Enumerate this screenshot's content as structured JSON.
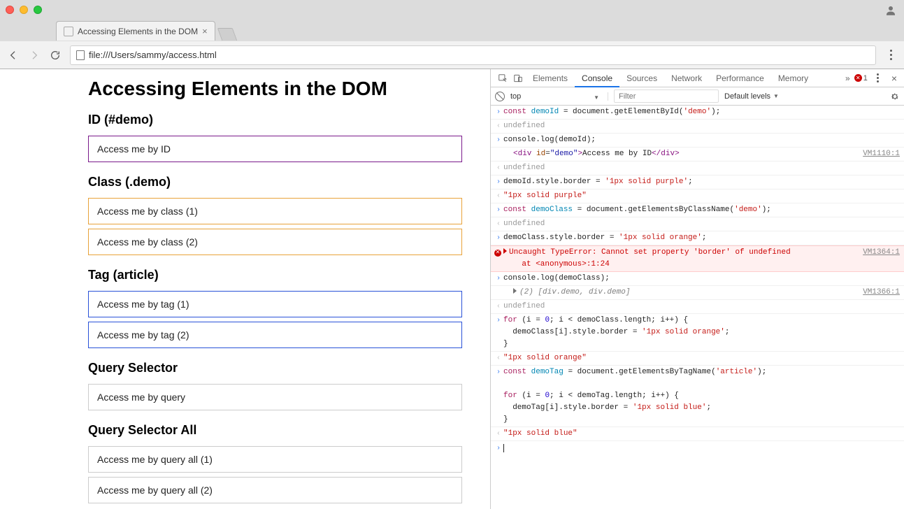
{
  "browser": {
    "tab_title": "Accessing Elements in the DOM",
    "url": "file:///Users/sammy/access.html"
  },
  "page": {
    "h1": "Accessing Elements in the DOM",
    "sections": {
      "id": {
        "heading": "ID (#demo)",
        "box1": "Access me by ID"
      },
      "class": {
        "heading": "Class (.demo)",
        "box1": "Access me by class (1)",
        "box2": "Access me by class (2)"
      },
      "tag": {
        "heading": "Tag (article)",
        "box1": "Access me by tag (1)",
        "box2": "Access me by tag (2)"
      },
      "query": {
        "heading": "Query Selector",
        "box1": "Access me by query"
      },
      "queryall": {
        "heading": "Query Selector All",
        "box1": "Access me by query all (1)",
        "box2": "Access me by query all (2)"
      }
    }
  },
  "devtools": {
    "tabs": [
      "Elements",
      "Console",
      "Sources",
      "Network",
      "Performance",
      "Memory"
    ],
    "active_tab": "Console",
    "error_count": "1",
    "context": "top",
    "filter_placeholder": "Filter",
    "levels": "Default levels",
    "console_rows": [
      {
        "type": "input",
        "html": "<span class='kw'>const</span> <span class='var'>demoId</span> <span class='plain'>= document.getElementById(</span><span class='str'>'demo'</span><span class='plain'>);</span>"
      },
      {
        "type": "output",
        "html": "<span class='undef'>undefined</span>"
      },
      {
        "type": "input",
        "html": "<span class='plain'>console.log(demoId);</span>"
      },
      {
        "type": "log",
        "indent": true,
        "src": "VM1110:1",
        "html": "<span class='tag'>&lt;div </span><span class='attr'>id</span><span class='plain'>=</span><span class='attrval'>\"demo\"</span><span class='tag'>&gt;</span><span class='plain'>Access me by ID</span><span class='tag'>&lt;/div&gt;</span>"
      },
      {
        "type": "output",
        "html": "<span class='undef'>undefined</span>"
      },
      {
        "type": "input",
        "html": "<span class='plain'>demoId.style.border = </span><span class='str'>'1px solid purple'</span><span class='plain'>;</span>"
      },
      {
        "type": "output",
        "html": "<span class='str'>\"1px solid purple\"</span>"
      },
      {
        "type": "input",
        "html": "<span class='kw'>const</span> <span class='var'>demoClass</span> <span class='plain'>= document.getElementsByClassName(</span><span class='str'>'demo'</span><span class='plain'>);</span>"
      },
      {
        "type": "output",
        "html": "<span class='undef'>undefined</span>"
      },
      {
        "type": "input",
        "html": "<span class='plain'>demoClass.style.border = </span><span class='str'>'1px solid orange'</span><span class='plain'>;</span>"
      },
      {
        "type": "error",
        "src": "VM1364:1",
        "html": "Uncaught TypeError: Cannot set property 'border' of undefined\n    at &lt;anonymous&gt;:1:24"
      },
      {
        "type": "input",
        "html": "<span class='plain'>console.log(demoClass);</span>"
      },
      {
        "type": "log",
        "indent": true,
        "expandable": true,
        "src": "VM1366:1",
        "html": "<span class='italic obj'>(2) [div.demo, div.demo]</span>"
      },
      {
        "type": "output",
        "html": "<span class='undef'>undefined</span>"
      },
      {
        "type": "input",
        "html": "<span class='kw'>for</span> <span class='plain'>(i = </span><span class='num'>0</span><span class='plain'>; i &lt; demoClass.length; i++) {</span>\n<span class='plain'>  demoClass[i].style.border = </span><span class='str'>'1px solid orange'</span><span class='plain'>;</span>\n<span class='plain'>}</span>"
      },
      {
        "type": "output",
        "html": "<span class='str'>\"1px solid orange\"</span>"
      },
      {
        "type": "input",
        "html": "<span class='kw'>const</span> <span class='var'>demoTag</span> <span class='plain'>= document.getElementsByTagName(</span><span class='str'>'article'</span><span class='plain'>);</span>\n\n<span class='kw'>for</span> <span class='plain'>(i = </span><span class='num'>0</span><span class='plain'>; i &lt; demoTag.length; i++) {</span>\n<span class='plain'>  demoTag[i].style.border = </span><span class='str'>'1px solid blue'</span><span class='plain'>;</span>\n<span class='plain'>}</span>"
      },
      {
        "type": "output",
        "html": "<span class='str'>\"1px solid blue\"</span>"
      }
    ]
  }
}
